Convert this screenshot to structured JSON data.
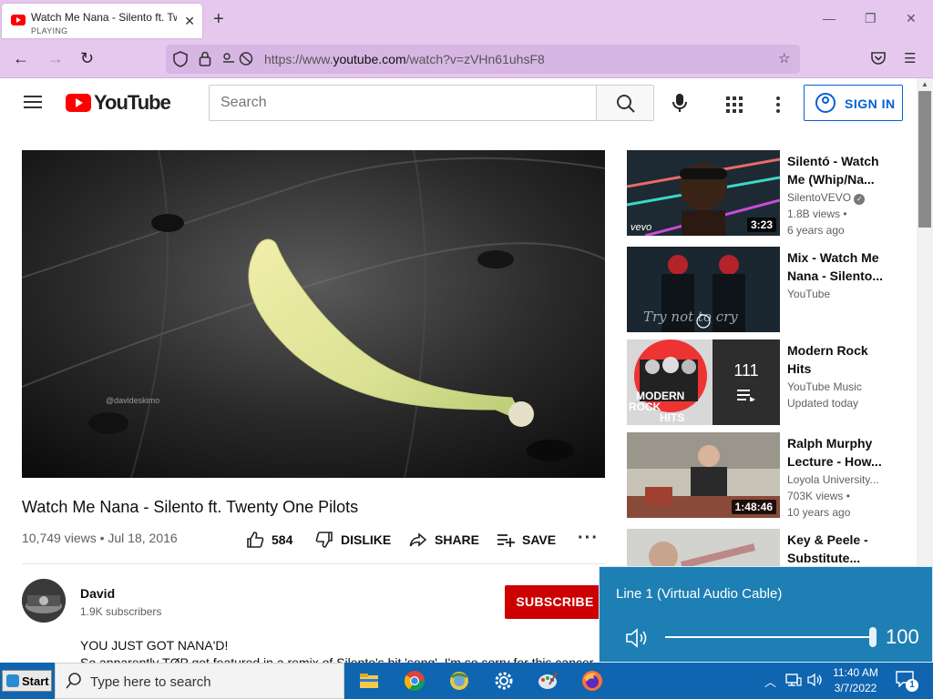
{
  "browser": {
    "tab_title": "Watch Me Nana - Silento ft. Twenty One Pilots",
    "tab_status": "PLAYING",
    "url_prefix": "https://www.",
    "url_domain": "youtube.com",
    "url_path": "/watch?v=zVHn61uhsF8"
  },
  "youtube": {
    "logo_text": "YouTube",
    "search_placeholder": "Search",
    "sign_in_label": "SIGN IN"
  },
  "video": {
    "title": "Watch Me Nana - Silento ft. Twenty One Pilots",
    "meta": "10,749 views • Jul 18, 2016",
    "likes": "584",
    "dislike_label": "DISLIKE",
    "share_label": "SHARE",
    "save_label": "SAVE",
    "watermark": "@davideskimo",
    "channel": {
      "name": "David",
      "subscribers": "1.9K subscribers",
      "subscribe_label": "SUBSCRIBE"
    },
    "description_line1": "YOU JUST GOT NANA'D!",
    "description_line2": "So apparently TØP got featured in a remix of Silento's hit 'song'. I'm so sorry for this cancer."
  },
  "recommendations": [
    {
      "title": "Silentó - Watch Me (Whip/Na...",
      "channel": "SilentoVEVO",
      "views": "1.8B views •",
      "date": "6 years ago",
      "duration": "3:23"
    },
    {
      "title": "Mix - Watch Me Nana - Silento...",
      "channel": "YouTube",
      "views": "",
      "date": "",
      "duration": ""
    },
    {
      "title": "Modern Rock Hits",
      "channel": "YouTube Music",
      "views": "Updated today",
      "date": "",
      "playlist_count": "111"
    },
    {
      "title": "Ralph Murphy Lecture - How...",
      "channel": "Loyola University...",
      "views": "703K views •",
      "date": "10 years ago",
      "duration": "1:48:46"
    },
    {
      "title": "Key & Peele - Substitute...",
      "channel": "",
      "views": "",
      "date": "",
      "duration": ""
    }
  ],
  "volume_popup": {
    "device": "Line 1 (Virtual Audio Cable)",
    "value": "100",
    "level": 1.0
  },
  "taskbar": {
    "start_label": "Start",
    "search_placeholder": "Type here to search",
    "time": "11:40 AM",
    "date": "3/7/2022",
    "notification_count": "1"
  }
}
